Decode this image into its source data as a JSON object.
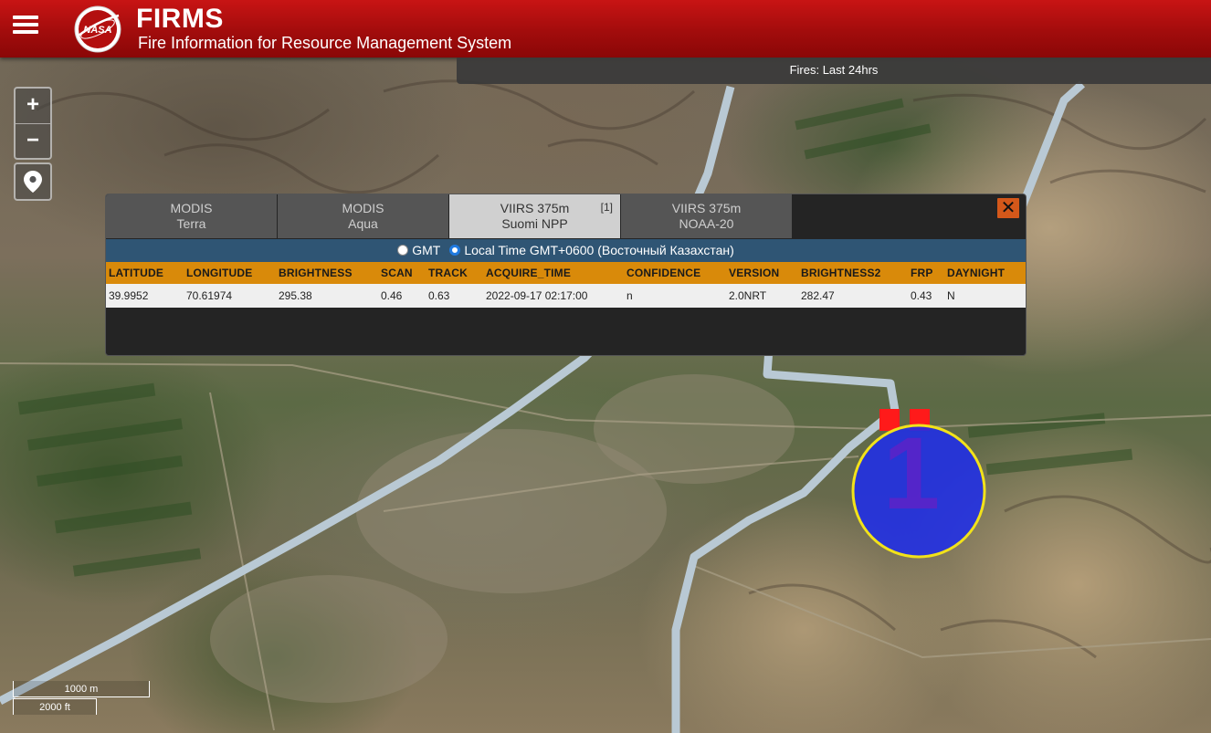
{
  "header": {
    "title": "FIRMS",
    "subtitle": "Fire Information for Resource Management System",
    "logo_text": "NASA"
  },
  "fires_bar": {
    "label": "Fires: Last 24hrs"
  },
  "map_controls": {
    "zoom_in": "+",
    "zoom_out": "−"
  },
  "popup": {
    "tabs": [
      {
        "line1": "MODIS",
        "line2": "Terra",
        "active": false
      },
      {
        "line1": "MODIS",
        "line2": "Aqua",
        "active": false
      },
      {
        "line1": "VIIRS 375m",
        "line2": "Suomi NPP",
        "count": "[1]",
        "active": true
      },
      {
        "line1": "VIIRS 375m",
        "line2": "NOAA-20",
        "active": false
      }
    ],
    "close_label": "✕",
    "timezone": {
      "gmt_label": "GMT",
      "local_label": "Local Time GMT+0600 (Восточный Казахстан)",
      "selected": "local"
    },
    "table": {
      "columns": [
        "LATITUDE",
        "LONGITUDE",
        "BRIGHTNESS",
        "SCAN",
        "TRACK",
        "ACQUIRE_TIME",
        "CONFIDENCE",
        "VERSION",
        "BRIGHTNESS2",
        "FRP",
        "DAYNIGHT"
      ],
      "rows": [
        [
          "39.9952",
          "70.61974",
          "295.38",
          "0.46",
          "0.63",
          "2022-09-17 02:17:00",
          "n",
          "2.0NRT",
          "282.47",
          "0.43",
          "N"
        ]
      ]
    }
  },
  "marker": {
    "count": "1",
    "fill": "#1f2ee8",
    "stroke": "#f2e21a",
    "pixel_color": "#ff1a1a"
  },
  "scale": {
    "metric": "1000 m",
    "imperial": "2000 ft"
  },
  "colors": {
    "header": "#b30f0f",
    "table_header": "#d98a0a",
    "timezone_bar": "#2f5574",
    "close": "#d4581a",
    "canal": "#b9c9d4"
  }
}
